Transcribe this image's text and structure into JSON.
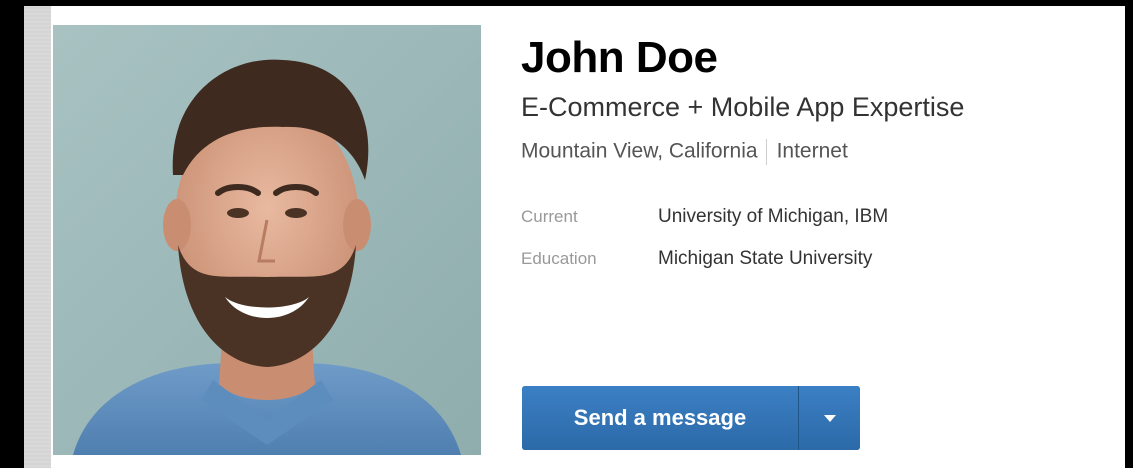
{
  "profile": {
    "name": "John Doe",
    "headline": "E-Commerce + Mobile App Expertise",
    "location": "Mountain View, California",
    "industry": "Internet",
    "current_label": "Current",
    "current_value": "University of Michigan, IBM",
    "education_label": "Education",
    "education_value": "Michigan State University",
    "photo_icon": "profile-photo-icon"
  },
  "actions": {
    "send_message_label": "Send a message",
    "more_options_icon": "caret-down-icon"
  },
  "colors": {
    "button": "#2e6ba8",
    "name": "#000000",
    "label": "#999999"
  }
}
